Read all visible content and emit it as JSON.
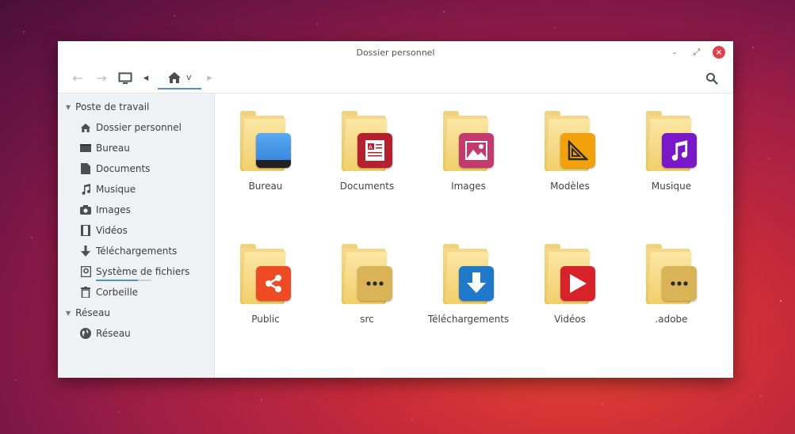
{
  "window": {
    "title": "Dossier personnel",
    "minimize_glyph": "–",
    "maximize_glyph": "⤢",
    "close_glyph": "×"
  },
  "toolbar": {
    "back_glyph": "←",
    "forward_glyph": "→",
    "prev_glyph": "◂",
    "next_glyph": "▸",
    "breadcrumb_label": "v"
  },
  "sidebar": {
    "sections": [
      {
        "label": "Poste de travail",
        "items": [
          {
            "label": "Dossier personnel",
            "icon": "home-icon"
          },
          {
            "label": "Bureau",
            "icon": "desktop-icon"
          },
          {
            "label": "Documents",
            "icon": "document-icon"
          },
          {
            "label": "Musique",
            "icon": "music-icon"
          },
          {
            "label": "Images",
            "icon": "camera-icon"
          },
          {
            "label": "Vidéos",
            "icon": "film-icon"
          },
          {
            "label": "Téléchargements",
            "icon": "download-icon"
          },
          {
            "label": "Système de fichiers",
            "icon": "drive-icon",
            "usage": 0.75
          },
          {
            "label": "Corbeille",
            "icon": "trash-icon"
          }
        ]
      },
      {
        "label": "Réseau",
        "items": [
          {
            "label": "Réseau",
            "icon": "globe-icon"
          }
        ]
      }
    ]
  },
  "files": [
    {
      "name": "Bureau",
      "emblem": "desktop-emblem-icon",
      "color": "#3a8fe0"
    },
    {
      "name": "Documents",
      "emblem": "document-emblem-icon",
      "color": "#b5202e"
    },
    {
      "name": "Images",
      "emblem": "image-emblem-icon",
      "color": "#c23a6e"
    },
    {
      "name": "Modèles",
      "emblem": "template-emblem-icon",
      "color": "#f2a10a"
    },
    {
      "name": "Musique",
      "emblem": "music-emblem-icon",
      "color": "#7a17c9"
    },
    {
      "name": "Public",
      "emblem": "share-emblem-icon",
      "color": "#ee4a24"
    },
    {
      "name": "src",
      "emblem": "more-emblem-icon",
      "color": "#d9b356"
    },
    {
      "name": "Téléchargements",
      "emblem": "download-emblem-icon",
      "color": "#1f79c8"
    },
    {
      "name": "Vidéos",
      "emblem": "play-emblem-icon",
      "color": "#d8222a"
    },
    {
      "name": ".adobe",
      "emblem": "more-emblem-icon",
      "color": "#d9b356"
    }
  ]
}
